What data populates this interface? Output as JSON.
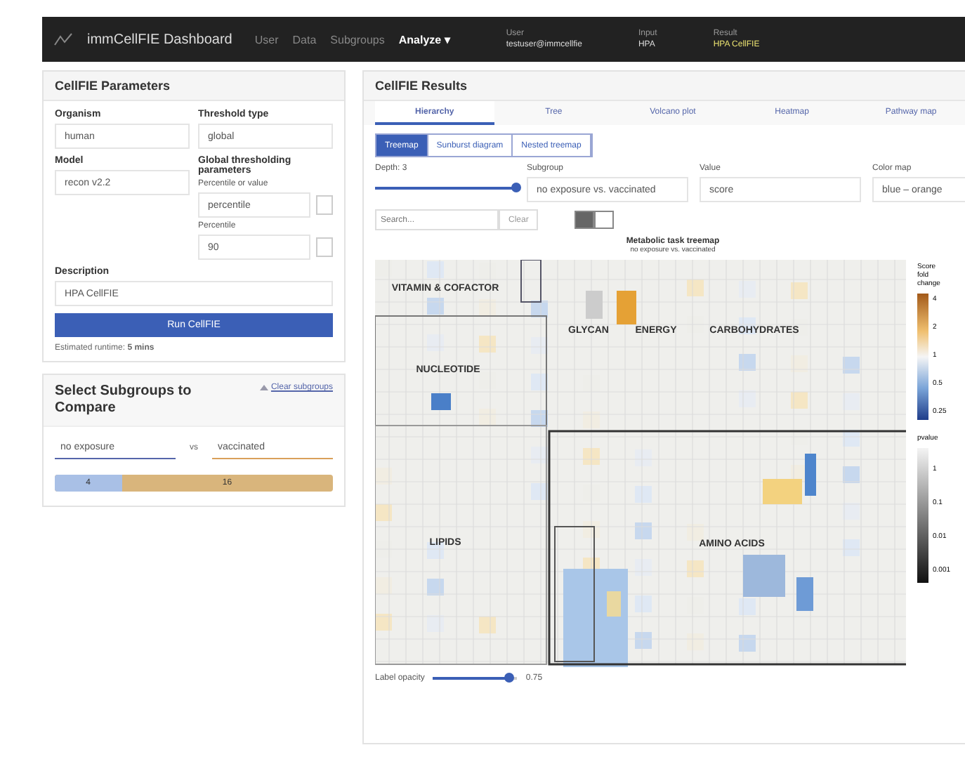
{
  "navbar": {
    "brand": "immCellFIE Dashboard",
    "links": [
      {
        "label": "User",
        "selected": false
      },
      {
        "label": "Data",
        "selected": false
      },
      {
        "label": "Subgroups",
        "selected": false
      },
      {
        "label": "Analyze ▾",
        "selected": true
      }
    ],
    "info": [
      {
        "label": "User",
        "value": "testuser@immcellfie",
        "highlight": false
      },
      {
        "label": "Input",
        "value": "HPA",
        "highlight": false
      },
      {
        "label": "Result",
        "value": "HPA CellFIE",
        "highlight": true
      }
    ]
  },
  "parameters": {
    "title": "CellFIE Parameters",
    "organism": {
      "label": "Organism",
      "value": "human"
    },
    "threshold_type": {
      "label": "Threshold type",
      "value": "global"
    },
    "model": {
      "label": "Model",
      "value": "recon v2.2"
    },
    "global_heading": "Global thresholding parameters",
    "percentile_or_value": {
      "label": "Percentile or value",
      "value": "percentile"
    },
    "percentile": {
      "label": "Percentile",
      "value": "90"
    },
    "description": {
      "label": "Description",
      "value": "HPA CellFIE"
    },
    "run_button": "Run CellFIE",
    "runtime": "Estimated runtime: **5 mins**"
  },
  "subgroups": {
    "title": "Select Subgroups to Compare",
    "clear_link": "Clear subgroups",
    "left": "no exposure",
    "vs": "vs",
    "right": "vaccinated",
    "split": {
      "level": 0.24,
      "left_count": "4",
      "right_count": "16"
    }
  },
  "results": {
    "title": "CellFIE Results",
    "tabs": [
      {
        "label": "Hierarchy",
        "selected": true
      },
      {
        "label": "Tree",
        "selected": false
      },
      {
        "label": "Volcano plot",
        "selected": false
      },
      {
        "label": "Heatmap",
        "selected": false
      },
      {
        "label": "Pathway map",
        "selected": false
      }
    ],
    "views": [
      {
        "label": "Treemap",
        "selected": true
      },
      {
        "label": "Sunburst diagram",
        "selected": false
      },
      {
        "label": "Nested treemap",
        "selected": false
      }
    ],
    "depth": {
      "label": "Depth: 3",
      "level": 1
    },
    "subgroup": {
      "label": "Subgroup",
      "value": "no exposure vs. vaccinated"
    },
    "value": {
      "label": "Value",
      "value": "score"
    },
    "color_map": {
      "label": "Color map",
      "value": "blue – orange"
    },
    "search": {
      "placeholder": "Search...",
      "clear": "Clear"
    },
    "mode_toggle": [
      {
        "selected": true
      },
      {
        "selected": false
      }
    ],
    "treemap": {
      "title": "Metabolic task treemap",
      "subtitle": "no exposure vs. vaccinated",
      "groups": [
        "VITAMIN & COFACTOR",
        "NUCLEOTIDE",
        "GLYCAN",
        "ENERGY",
        "CARBOHYDRATES",
        "LIPIDS",
        "AMINO ACIDS"
      ],
      "score_legend": {
        "title": "Score fold change",
        "ticks": [
          "4",
          "2",
          "1",
          "0.5",
          "0.25"
        ]
      },
      "pvalue_legend": {
        "title": "pvalue",
        "ticks": [
          "1",
          "0.1",
          "0.01",
          "0.001"
        ]
      }
    },
    "label_opacity": {
      "label": "Label opacity",
      "reading": "0.75"
    }
  }
}
